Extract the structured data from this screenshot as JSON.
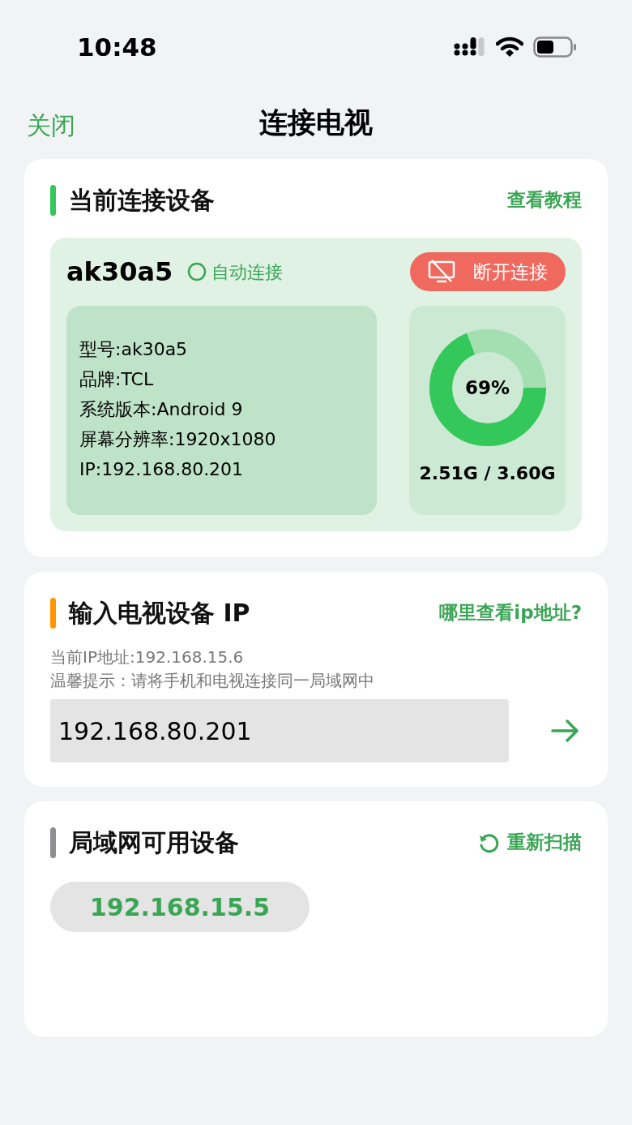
{
  "status_bar": {
    "time": "10:48"
  },
  "nav": {
    "close": "关闭",
    "title": "连接电视"
  },
  "sections": [
    {
      "kind": "current",
      "title": "当前连接设备",
      "color": "#34c759",
      "link": "查看教程",
      "device": {
        "name": "ak30a5",
        "auto": "自动连接",
        "disconnect": "断开连接",
        "details": [
          "型号:ak30a5",
          "品牌:TCL",
          "系统版本:Android 9",
          "屏幕分辨率:1920x1080",
          "IP:192.168.80.201"
        ],
        "storage": {
          "level": 0.69,
          "percent": "69%",
          "reading": "2.51G / 3.60G"
        }
      }
    },
    {
      "kind": "input",
      "title": "输入电视设备 IP",
      "color": "#ff9500",
      "link": "哪里查看ip地址?",
      "notes": [
        "当前IP地址:192.168.15.6",
        "温馨提示：请将手机和电视连接同一局域网中"
      ],
      "value": "192.168.80.201"
    },
    {
      "kind": "lan",
      "title": "局域网可用设备",
      "color": "#8e8e93",
      "link": "重新扫描",
      "devices": [
        "192.168.15.5"
      ]
    }
  ]
}
